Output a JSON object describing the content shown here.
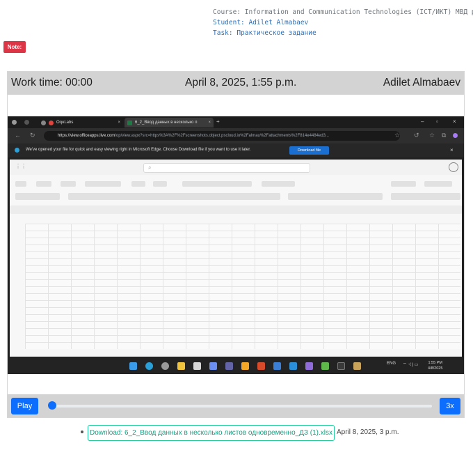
{
  "meta": {
    "course": "Course: Information and Communication Technologies (ICT/ИКТ) МВД р/о",
    "student": "Student: Adilet Almabaev",
    "task": "Task: Практическое задание"
  },
  "note_label": "Note:",
  "player": {
    "work_time": "Work time: 00:00",
    "datetime": "April 8, 2025, 1:55 p.m.",
    "student_name": "Adilet Almabaev",
    "play_label": "Play",
    "speed_label": "3x",
    "progress": 0
  },
  "screenshot": {
    "tabs": [
      {
        "label": "OquLabs"
      },
      {
        "label": "6_2_Ввод данных в несколько л"
      }
    ],
    "url_domain": "https://view.officeapps.live.com",
    "url_rest": "/op/view.aspx?src=https%3A%2F%2Fscreenshots.object.pscloud.io%2Falmau%2Fattachments%2F814e4484ed3...",
    "info_text": "We've opened your file for quick and easy viewing right in Microsoft Edge. Choose Download file if you want to use it later.",
    "download_btn": "Download file",
    "tray_lang": "ENG",
    "clock_time": "1:55 PM",
    "clock_date": "4/8/2025"
  },
  "download_link": "Download: 6_2_Ввод данных в несколько листов одновременно_ДЗ (1).xlsx",
  "download_date": "April 8, 2025, 3 p.m.",
  "colors": {
    "primary": "#0d6efd",
    "danger": "#dc3545",
    "link": "#20c997"
  }
}
